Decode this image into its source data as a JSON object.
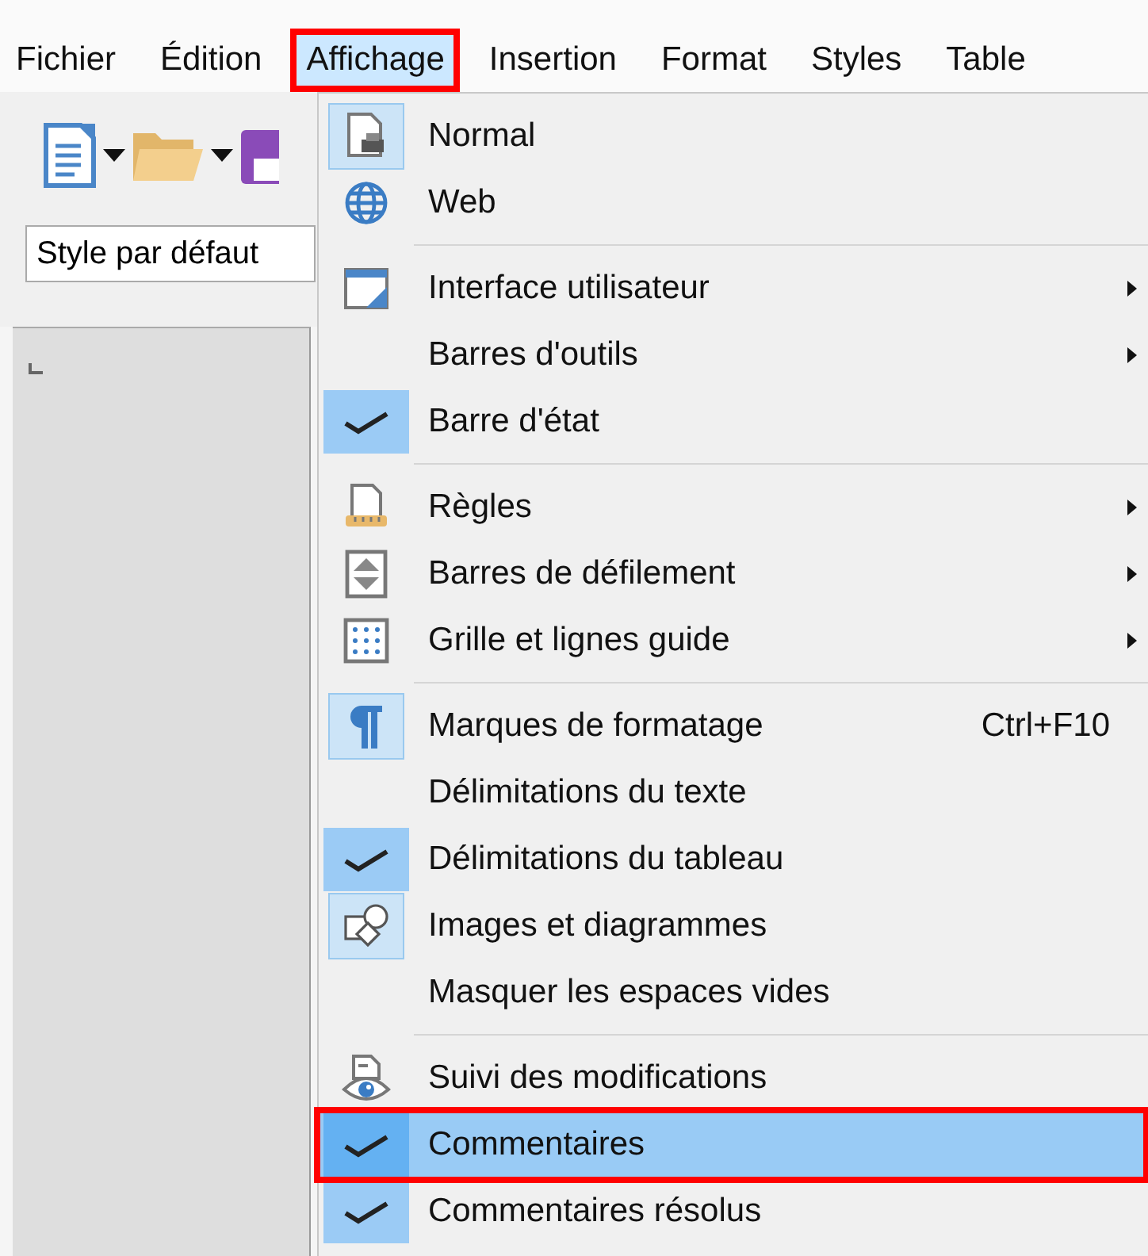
{
  "menubar": [
    {
      "label": "Fichier",
      "open": false,
      "outlined": false
    },
    {
      "label": "Édition",
      "open": false,
      "outlined": false
    },
    {
      "label": "Affichage",
      "open": true,
      "outlined": true
    },
    {
      "label": "Insertion",
      "open": false,
      "outlined": false
    },
    {
      "label": "Format",
      "open": false,
      "outlined": false
    },
    {
      "label": "Styles",
      "open": false,
      "outlined": false
    },
    {
      "label": "Table",
      "open": false,
      "outlined": false
    }
  ],
  "toolbar": {
    "paragraph_style": "Style par défaut"
  },
  "menu": {
    "items": [
      {
        "kind": "page",
        "label": "Normal",
        "checked": true,
        "submenu": false,
        "selected": false,
        "outlined": false
      },
      {
        "kind": "globe",
        "label": "Web",
        "checked": false,
        "submenu": false,
        "selected": false,
        "outlined": false
      },
      {
        "kind": "separator"
      },
      {
        "kind": "window",
        "label": "Interface utilisateur",
        "checked": false,
        "submenu": true,
        "selected": false,
        "outlined": false
      },
      {
        "kind": "plain",
        "label": "Barres d'outils",
        "checked": false,
        "submenu": true,
        "selected": false,
        "outlined": false
      },
      {
        "kind": "plain",
        "label": "Barre d'état",
        "checked": true,
        "submenu": false,
        "selected": false,
        "outlined": false
      },
      {
        "kind": "separator"
      },
      {
        "kind": "ruler",
        "label": "Règles",
        "checked": false,
        "submenu": true,
        "selected": false,
        "outlined": false
      },
      {
        "kind": "scrollbar",
        "label": "Barres de défilement",
        "checked": false,
        "submenu": true,
        "selected": false,
        "outlined": false
      },
      {
        "kind": "grid",
        "label": "Grille et lignes guide",
        "checked": false,
        "submenu": true,
        "selected": false,
        "outlined": false
      },
      {
        "kind": "separator"
      },
      {
        "kind": "pilcrow",
        "label": "Marques de formatage",
        "shortcut": "Ctrl+F10",
        "checked": true,
        "submenu": false,
        "selected": false,
        "outlined": false
      },
      {
        "kind": "plain",
        "label": "Délimitations du texte",
        "checked": false,
        "submenu": false,
        "selected": false,
        "outlined": false
      },
      {
        "kind": "plain",
        "label": "Délimitations du tableau",
        "checked": true,
        "submenu": false,
        "selected": false,
        "outlined": false
      },
      {
        "kind": "shapes",
        "label": "Images et diagrammes",
        "checked": true,
        "submenu": false,
        "selected": false,
        "outlined": false
      },
      {
        "kind": "plain",
        "label": "Masquer les espaces vides",
        "checked": false,
        "submenu": false,
        "selected": false,
        "outlined": false
      },
      {
        "kind": "separator"
      },
      {
        "kind": "eye",
        "label": "Suivi des modifications",
        "checked": false,
        "submenu": false,
        "selected": false,
        "outlined": false
      },
      {
        "kind": "plain",
        "label": "Commentaires",
        "checked": true,
        "submenu": false,
        "selected": true,
        "outlined": true
      },
      {
        "kind": "plain",
        "label": "Commentaires résolus",
        "checked": true,
        "submenu": false,
        "selected": false,
        "outlined": false
      }
    ]
  }
}
